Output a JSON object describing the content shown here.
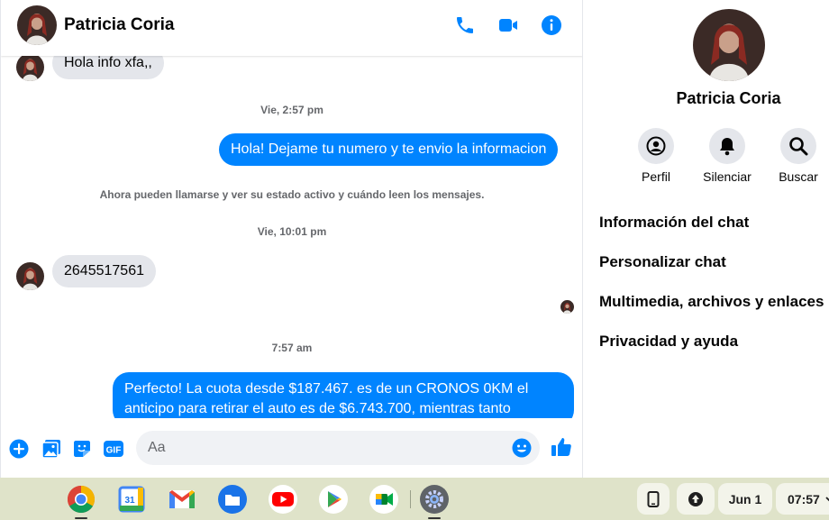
{
  "contact": {
    "name": "Patricia Coria"
  },
  "header": {
    "icons": [
      "phone-icon",
      "video-camera-icon",
      "info-icon"
    ]
  },
  "conversation": {
    "incoming_1": "Hola info xfa,,",
    "timestamp_1": "Vie, 2:57 pm",
    "outgoing_1": "Hola! Dejame tu numero y te envio la informacion",
    "system_note": "Ahora pueden llamarse y ver su estado activo y cuándo leen los mensajes.",
    "timestamp_2": "Vie, 10:01 pm",
    "incoming_2": "2645517561",
    "timestamp_3": "7:57 am",
    "outgoing_2": "Perfecto! La cuota desde $187.467. es de un CRONOS 0KM el anticipo para retirar el auto es de $6.743.700, mientras tanto"
  },
  "composer": {
    "placeholder": "Aa",
    "icons": [
      "plus-icon",
      "image-icon",
      "sticker-icon",
      "gif-icon",
      "emoji-icon",
      "thumbs-up-icon"
    ],
    "gif_label": "GIF"
  },
  "info_panel": {
    "name": "Patricia Coria",
    "actions": [
      {
        "label": "Perfil",
        "icon": "profile-icon"
      },
      {
        "label": "Silenciar",
        "icon": "bell-icon"
      },
      {
        "label": "Buscar",
        "icon": "search-icon"
      }
    ],
    "menu": [
      "Información del chat",
      "Personalizar chat",
      "Multimedia, archivos y enlaces",
      "Privacidad y ayuda"
    ]
  },
  "shelf": {
    "apps": [
      "chrome-icon",
      "calendar-icon",
      "gmail-icon",
      "files-icon",
      "youtube-icon",
      "play-store-icon",
      "meet-icon",
      "settings-icon"
    ],
    "calendar_day": "31",
    "date": "Jun 1",
    "time": "07:57"
  },
  "colors": {
    "accent": "#0084ff",
    "bubble_incoming": "#e4e6eb",
    "shelf": "#dfe3c9"
  }
}
